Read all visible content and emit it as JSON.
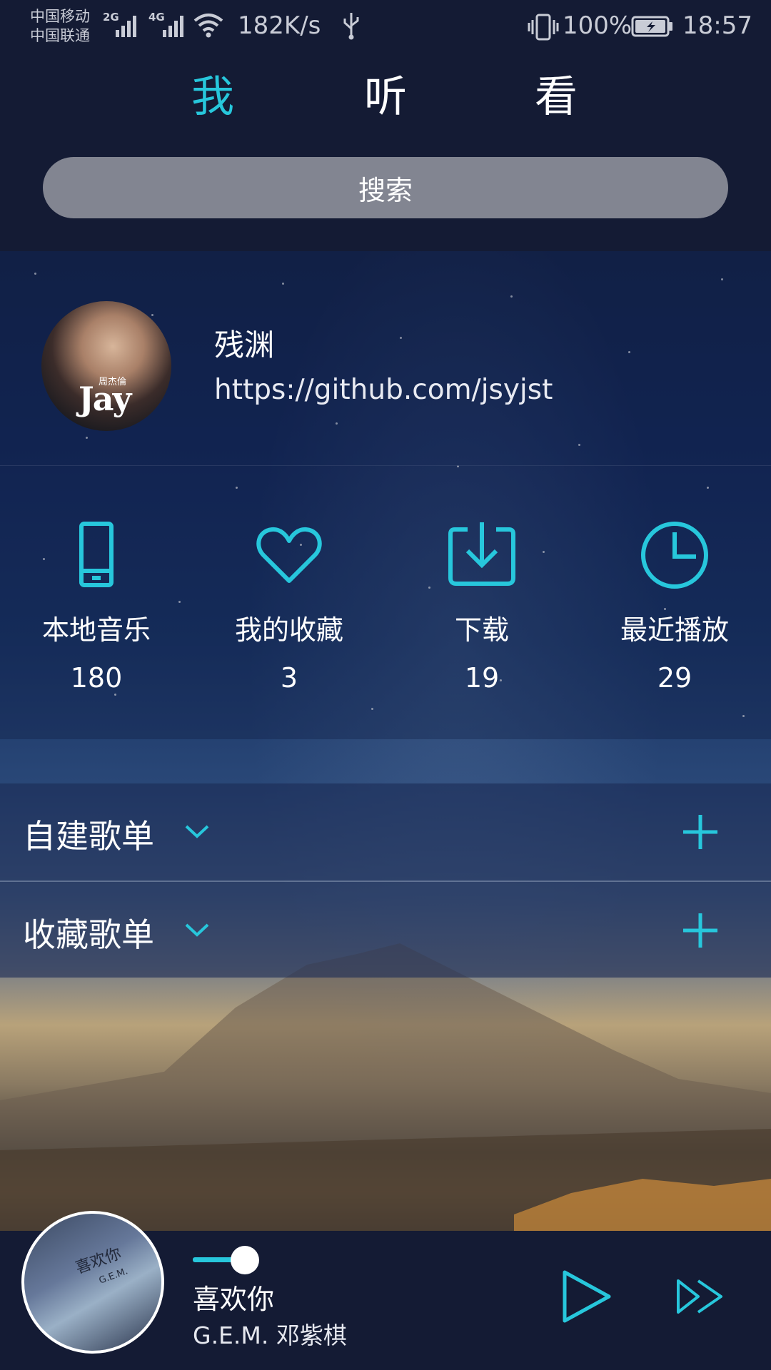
{
  "status_bar": {
    "carrier_1": "中国移动",
    "carrier_2": "中国联通",
    "network_1": "2G",
    "network_2": "4G",
    "speed": "182K/s",
    "battery": "100%",
    "time": "18:57"
  },
  "tabs": [
    {
      "label": "我",
      "active": true
    },
    {
      "label": "听",
      "active": false
    },
    {
      "label": "看",
      "active": false
    }
  ],
  "search": {
    "label": "搜索"
  },
  "profile": {
    "name": "残渊",
    "link": "https://github.com/jsyjst",
    "avatar_text": "Jay",
    "avatar_small_text": "周杰倫"
  },
  "stats": [
    {
      "label": "本地音乐",
      "count": "180",
      "icon": "phone-icon"
    },
    {
      "label": "我的收藏",
      "count": "3",
      "icon": "heart-icon"
    },
    {
      "label": "下载",
      "count": "19",
      "icon": "download-icon"
    },
    {
      "label": "最近播放",
      "count": "29",
      "icon": "clock-icon"
    }
  ],
  "playlists": {
    "self_built": "自建歌单",
    "collected": "收藏歌单"
  },
  "player": {
    "title": "喜欢你",
    "artist": "G.E.M. 邓紫棋",
    "cover_text": "喜欢你",
    "cover_small_text": "G.E.M.",
    "progress": 0.08
  },
  "colors": {
    "accent": "#27c7dc",
    "background": "#141b34",
    "search_box": "#828591"
  }
}
